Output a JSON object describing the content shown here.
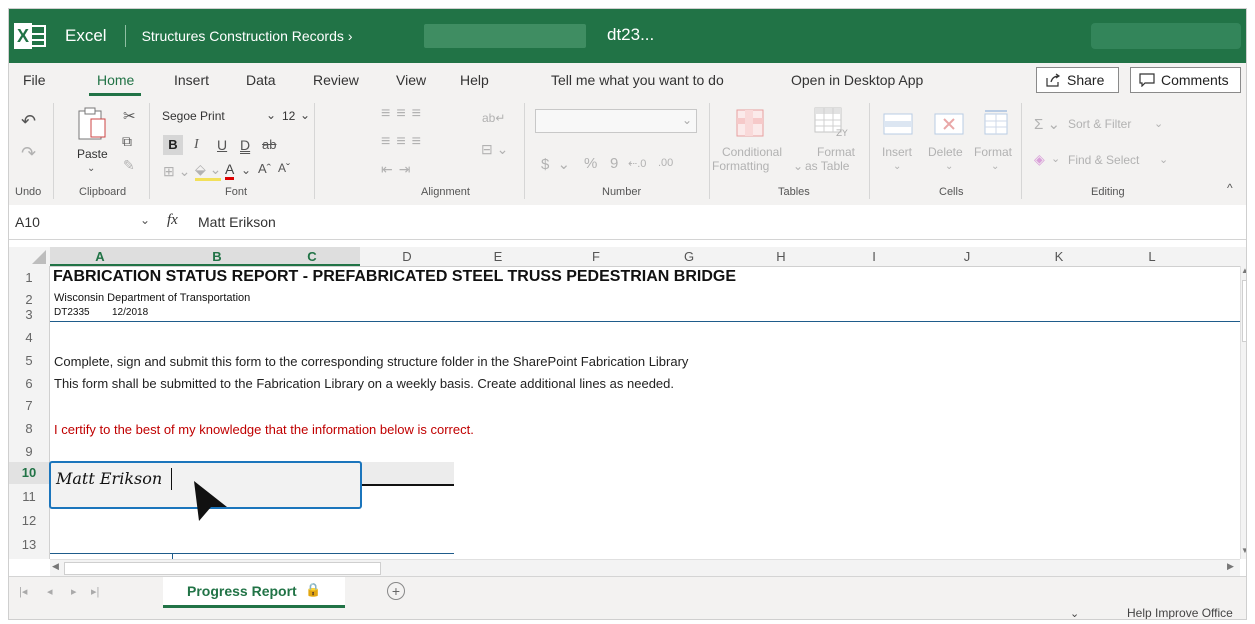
{
  "titlebar": {
    "app_name": "Excel",
    "breadcrumb": "Structures Construction Records",
    "breadcrumb_arrow": "›",
    "doc_title": "dt23...",
    "brand_color": "#217346"
  },
  "menu": {
    "items": [
      "File",
      "Home",
      "Insert",
      "Data",
      "Review",
      "View",
      "Help",
      "Tell me what you want to do",
      "Open in Desktop App"
    ],
    "share": "Share",
    "comments": "Comments"
  },
  "ribbon": {
    "undo_label": "Undo",
    "clipboard": {
      "label": "Clipboard",
      "paste": "Paste"
    },
    "font": {
      "label": "Font",
      "name": "Segoe Print",
      "size": "12"
    },
    "alignment": {
      "label": "Alignment"
    },
    "number": {
      "label": "Number",
      "format": ""
    },
    "tables": {
      "label": "Tables",
      "conditional1": "Conditional",
      "conditional2": "Formatting",
      "format1": "Format",
      "format2": "as Table"
    },
    "cells": {
      "label": "Cells",
      "insert": "Insert",
      "delete": "Delete",
      "format": "Format"
    },
    "editing": {
      "label": "Editing",
      "sort": "Sort & Filter",
      "find": "Find & Select"
    }
  },
  "formula_bar": {
    "name_box": "A10",
    "fx": "fx",
    "value": "Matt Erikson"
  },
  "columns": [
    "A",
    "B",
    "C",
    "D",
    "E",
    "F",
    "G",
    "H",
    "I",
    "J",
    "K",
    "L"
  ],
  "rows": [
    "1",
    "2",
    "3",
    "4",
    "5",
    "6",
    "7",
    "8",
    "9",
    "10",
    "11",
    "12",
    "13"
  ],
  "cells": {
    "r1": "FABRICATION STATUS REPORT - PREFABRICATED STEEL TRUSS PEDESTRIAN BRIDGE",
    "r2": "Wisconsin Department of Transportation",
    "r3a": "DT2335",
    "r3b": "12/2018",
    "r5": "Complete, sign and submit this form to the corresponding structure folder in the SharePoint Fabrication Library",
    "r6": "This form shall be submitted to the Fabrication Library on a weekly basis.  Create additional lines as needed.",
    "r8": "I certify to the best of my knowledge that the information below is correct.",
    "r10": "Matt Erikson"
  },
  "sheet_tabs": {
    "active": "Progress Report"
  },
  "statusbar": {
    "help": "Help Improve Office"
  }
}
